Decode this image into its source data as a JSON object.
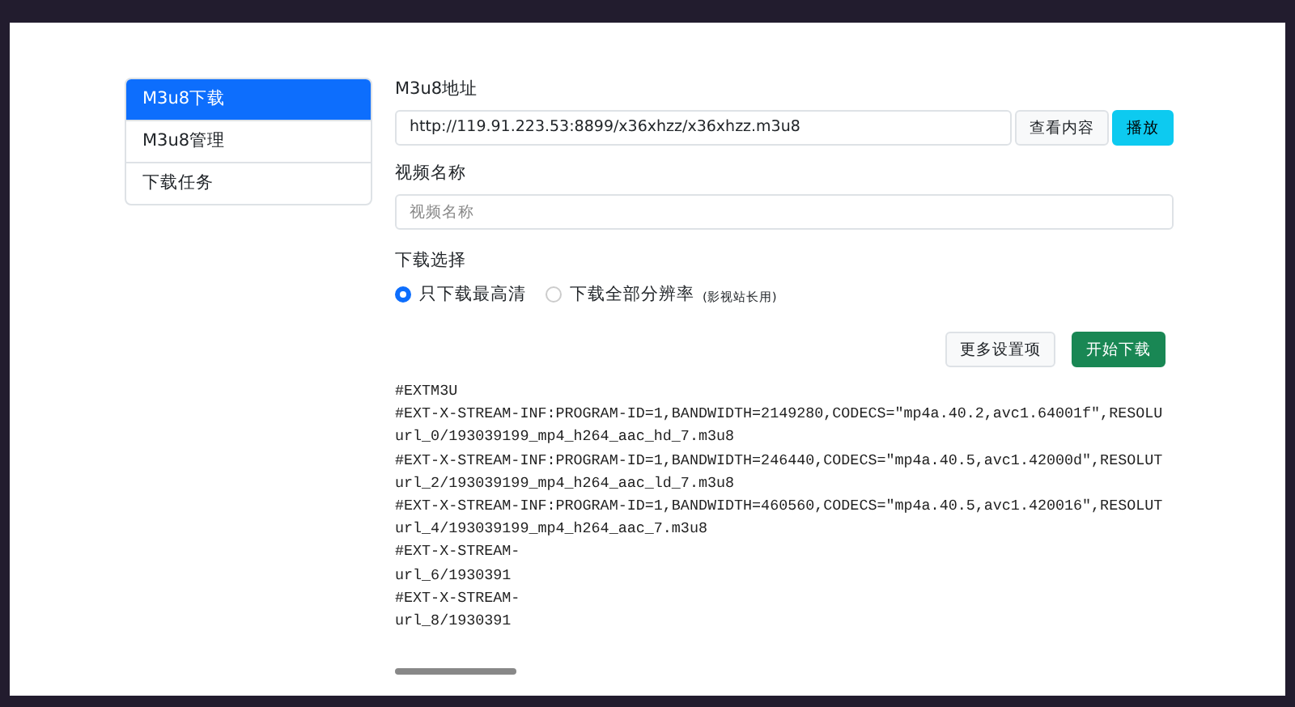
{
  "sidebar": {
    "items": [
      {
        "label": "M3u8下载",
        "selected": true
      },
      {
        "label": "M3u8管理",
        "selected": false
      },
      {
        "label": "下载任务",
        "selected": false
      }
    ]
  },
  "form": {
    "url_label": "M3u8地址",
    "url_value": "http://119.91.223.53:8899/x36xhzz/x36xhzz.m3u8",
    "view_button": "查看内容",
    "play_button": "播放",
    "name_label": "视频名称",
    "name_placeholder": "视频名称",
    "choice_label": "下载选择",
    "options": [
      {
        "label": "只下载最高清",
        "selected": true
      },
      {
        "label": "下载全部分辨率",
        "note": "(影视站长用)",
        "selected": false
      }
    ],
    "more_button": "更多设置项",
    "start_button": "开始下载"
  },
  "content_lines": [
    "#EXTM3U",
    "#EXT-X-STREAM-INF:PROGRAM-ID=1,BANDWIDTH=2149280,CODECS=\"mp4a.40.2,avc1.64001f\",RESOLU",
    "url_0/193039199_mp4_h264_aac_hd_7.m3u8",
    "#EXT-X-STREAM-INF:PROGRAM-ID=1,BANDWIDTH=246440,CODECS=\"mp4a.40.5,avc1.42000d\",RESOLUT",
    "url_2/193039199_mp4_h264_aac_ld_7.m3u8",
    "#EXT-X-STREAM-INF:PROGRAM-ID=1,BANDWIDTH=460560,CODECS=\"mp4a.40.5,avc1.420016\",RESOLUT",
    "url_4/193039199_mp4_h264_aac_7.m3u8",
    "#EXT-X-STREAM-",
    "url_6/1930391",
    "#EXT-X-STREAM-",
    "url_8/1930391"
  ]
}
